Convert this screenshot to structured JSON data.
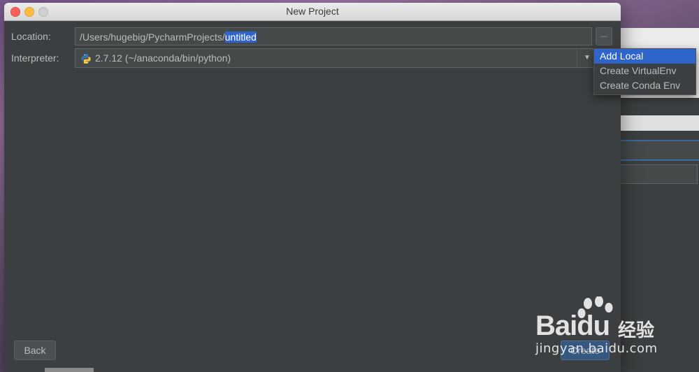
{
  "window": {
    "title": "New Project"
  },
  "location": {
    "label": "Location:",
    "path_prefix": "/Users/hugebig/PycharmProjects/",
    "path_selected": "untitled",
    "browse_label": "..."
  },
  "interpreter": {
    "label": "Interpreter:",
    "value": "2.7.12 (~/anaconda/bin/python)",
    "icon": "python-icon"
  },
  "menu": {
    "items": [
      "Add Local",
      "Create VirtualEnv",
      "Create Conda Env"
    ],
    "selected": "Add Local"
  },
  "footer": {
    "back_label": "Back",
    "create_label": "Create"
  },
  "watermark": {
    "brand": "Bai",
    "brand2": "du",
    "cn": "经验",
    "url": "jingyan.baidu.com"
  },
  "colors": {
    "selection": "#2f65ca",
    "dialog_bg": "#3c3f41",
    "field_bg": "#45494a"
  }
}
